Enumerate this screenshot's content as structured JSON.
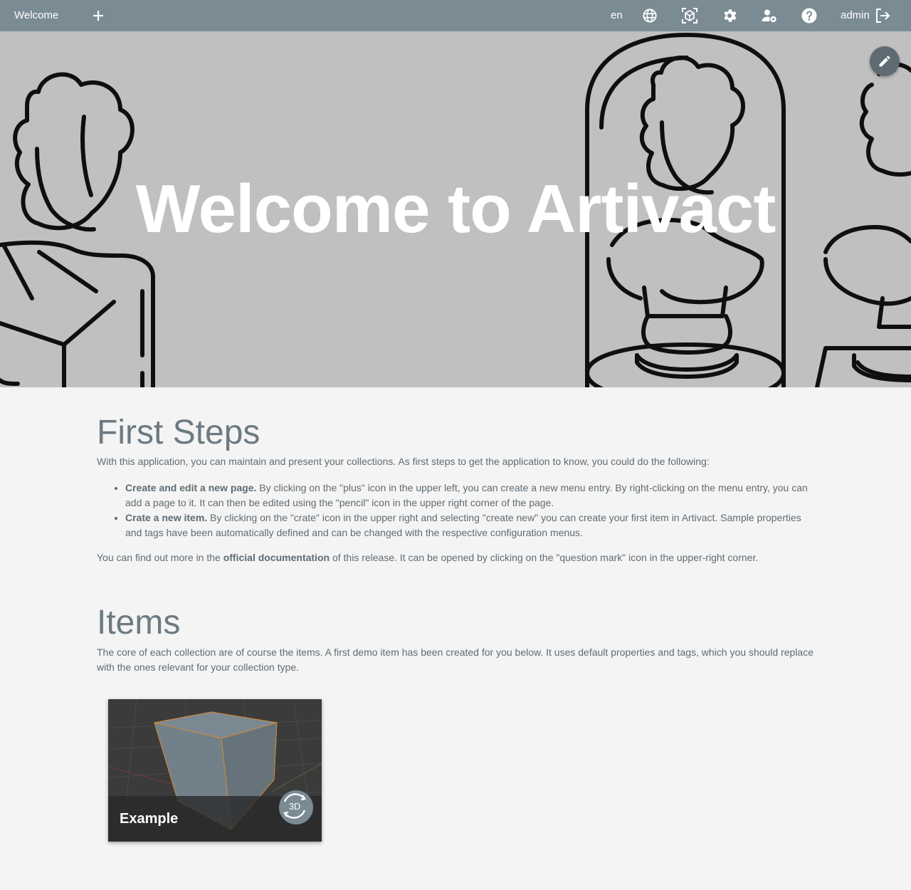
{
  "topbar": {
    "menu_title": "Welcome",
    "language": "en",
    "user": "admin",
    "background": "#7a8b94"
  },
  "hero": {
    "title": "Welcome to Artivact",
    "background": "#c0c0c0"
  },
  "first_steps": {
    "heading": "First Steps",
    "intro": "With this application, you can maintain and present your collections. As first steps to get the application to know, you could do the following:",
    "items": [
      {
        "bold": "Create and edit a new page.",
        "text": " By clicking on the \"plus\" icon in the upper left, you can create a new menu entry. By right-clicking on the menu entry, you can add a page to it. It can then be edited using the \"pencil\" icon in the upper right corner of the page."
      },
      {
        "bold": "Crate a new item.",
        "text": " By clicking on the \"crate\" icon in the upper right and selecting \"create new\" you can create your first item in Artivact. Sample properties and tags have been automatically defined and can be changed with the respective configuration menus."
      }
    ],
    "outro_pre": "You can find out more in the ",
    "outro_bold": "official documentation",
    "outro_post": " of this release. It can be opened by clicking on the \"question mark\" icon in the upper-right corner."
  },
  "items_section": {
    "heading": "Items",
    "text": "The core of each collection are of course the items. A first demo item has been created for you below. It uses default properties and tags, which you should replace with the ones relevant for your collection type.",
    "cards": [
      {
        "title": "Example",
        "badge": "3D"
      }
    ]
  },
  "icons": {
    "add": "plus-icon",
    "locale": "globe-icon",
    "items": "crate-3d-icon",
    "settings": "gear-icon",
    "account": "user-settings-icon",
    "help": "help-icon",
    "logout": "logout-icon",
    "edit": "pencil-icon",
    "model": "rotate-3d-icon"
  }
}
